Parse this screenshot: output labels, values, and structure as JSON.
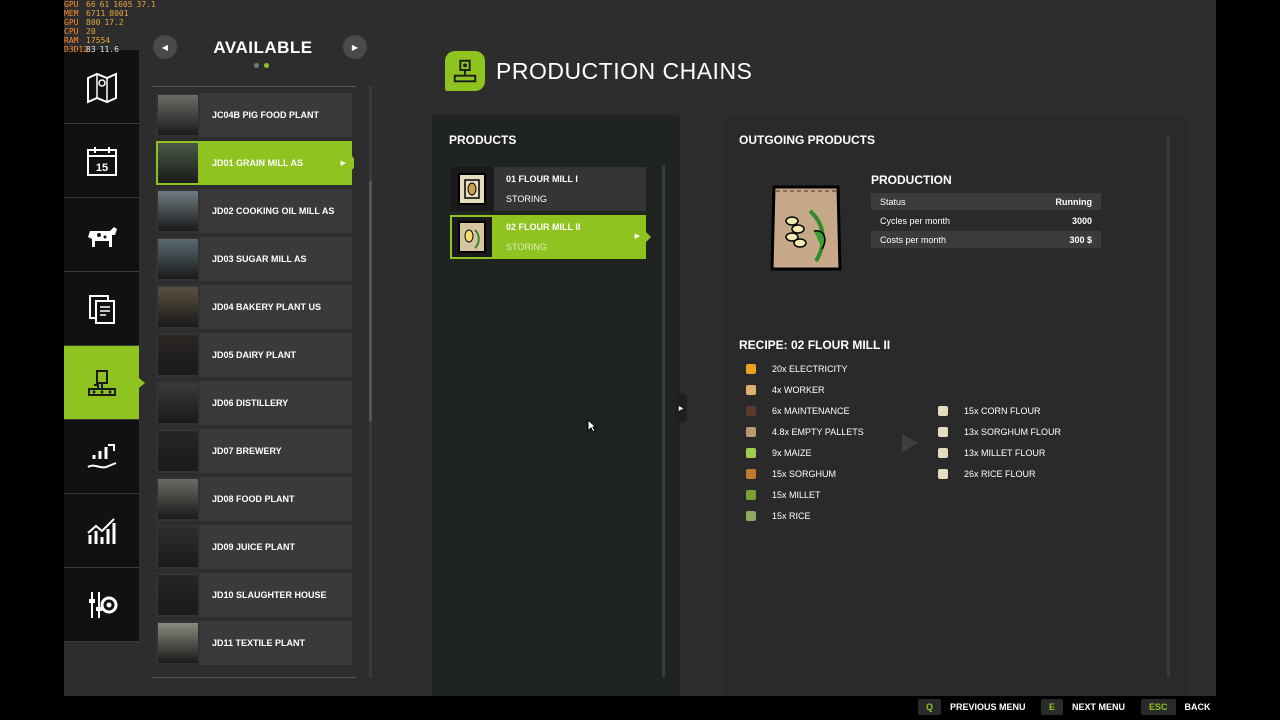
{
  "overlay": [
    {
      "label": "GPU",
      "a": "66",
      "b": "61",
      "c": "1605",
      "d": "37.1"
    },
    {
      "label": "MEM",
      "a": "6711",
      "b": "8001"
    },
    {
      "label": "GPU",
      "a": "800",
      "b": "17.2"
    },
    {
      "label": "CPU",
      "a": "20"
    },
    {
      "label": "RAM",
      "a": "17554"
    },
    {
      "label": "D3D12",
      "a": "83",
      "b": "11.6"
    }
  ],
  "rail": {
    "items": [
      "map-icon",
      "calendar-icon",
      "animals-icon",
      "contracts-icon",
      "production-icon",
      "finances-icon",
      "statistics-icon",
      "settings-icon"
    ],
    "calendar_day": "15",
    "active_index": 4
  },
  "available": {
    "title": "AVAILABLE",
    "prev_symbol": "◀",
    "next_symbol": "▶",
    "items": [
      {
        "label": "JC04B PIG FOOD PLANT"
      },
      {
        "label": "JD01 GRAIN MILL AS"
      },
      {
        "label": "JD02 COOKING OIL MILL AS"
      },
      {
        "label": "JD03 SUGAR MILL AS"
      },
      {
        "label": "JD04 BAKERY PLANT US"
      },
      {
        "label": "JD05 DAIRY PLANT"
      },
      {
        "label": "JD06 DISTILLERY"
      },
      {
        "label": "JD07 BREWERY"
      },
      {
        "label": "JD08 FOOD PLANT"
      },
      {
        "label": "JD09 JUICE PLANT"
      },
      {
        "label": "JD10 SLAUGHTER HOUSE"
      },
      {
        "label": "JD11 TEXTILE PLANT"
      }
    ],
    "active_index": 1,
    "caret": "▶"
  },
  "page": {
    "title": "PRODUCTION CHAINS"
  },
  "products": {
    "title": "PRODUCTS",
    "items": [
      {
        "name": "01 FLOUR MILL I",
        "status": "STORING"
      },
      {
        "name": "02 FLOUR MILL II",
        "status": "STORING"
      }
    ],
    "active_index": 1
  },
  "outgoing": {
    "title": "OUTGOING PRODUCTS",
    "production_label": "PRODUCTION",
    "stats": [
      {
        "label": "Status",
        "value": "Running"
      },
      {
        "label": "Cycles per month",
        "value": "3000"
      },
      {
        "label": "Costs per month",
        "value": "300 $"
      }
    ],
    "recipe_title": "RECIPE: 02 FLOUR MILL II",
    "inputs": [
      {
        "text": "20x ELECTRICITY",
        "icon": "electricity-icon",
        "color": "#f0a020"
      },
      {
        "text": "4x WORKER",
        "icon": "worker-icon",
        "color": "#e0b070"
      },
      {
        "text": "6x MAINTENANCE",
        "icon": "maintenance-icon",
        "color": "#5a3a2a"
      },
      {
        "text": "4.8x EMPTY PALLETS",
        "icon": "pallet-icon",
        "color": "#b89a70"
      },
      {
        "text": "9x MAIZE",
        "icon": "maize-icon",
        "color": "#9fcf4a"
      },
      {
        "text": "15x SORGHUM",
        "icon": "sorghum-icon",
        "color": "#c07a30"
      },
      {
        "text": "15x MILLET",
        "icon": "millet-icon",
        "color": "#7aa030"
      },
      {
        "text": "15x RICE",
        "icon": "rice-icon",
        "color": "#90a860"
      }
    ],
    "outputs": [
      {
        "text": "15x CORN FLOUR",
        "icon": "corn-flour-icon"
      },
      {
        "text": "13x SORGHUM FLOUR",
        "icon": "sorghum-flour-icon"
      },
      {
        "text": "13x MILLET FLOUR",
        "icon": "millet-flour-icon"
      },
      {
        "text": "26x RICE FLOUR",
        "icon": "rice-flour-icon"
      }
    ]
  },
  "footer": [
    {
      "key": "Q",
      "label": "PREVIOUS MENU"
    },
    {
      "key": "E",
      "label": "NEXT MENU"
    },
    {
      "key": "ESC",
      "label": "BACK"
    }
  ],
  "colors": {
    "accent": "#8fc31f",
    "panel": "#2d2d2d",
    "rail": "#111111"
  }
}
